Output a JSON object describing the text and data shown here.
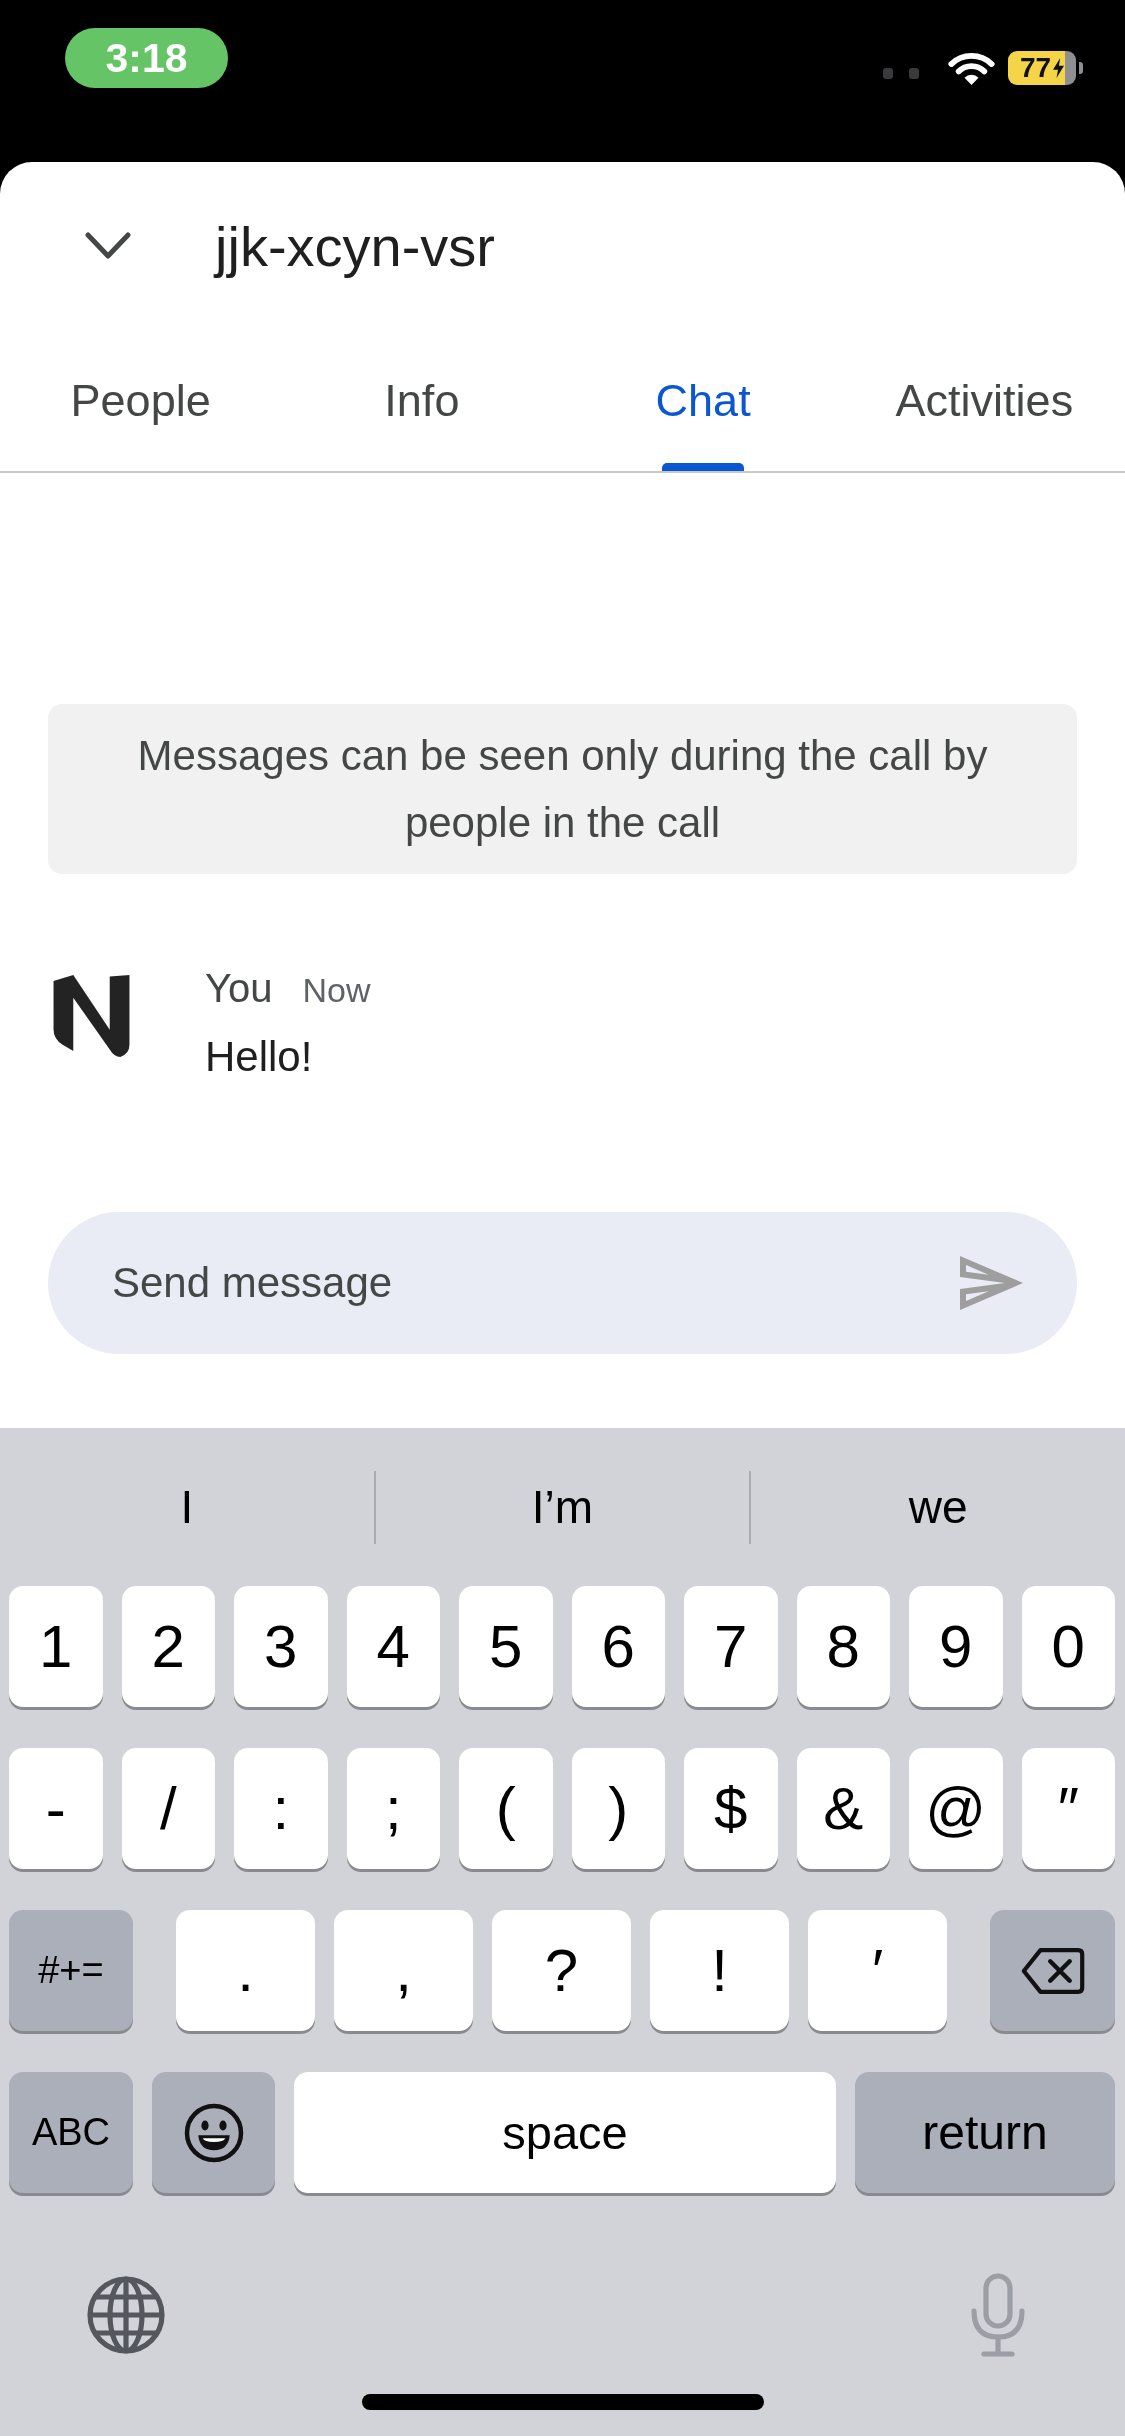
{
  "status_bar": {
    "time": "3:18",
    "battery": "77",
    "charging": true
  },
  "header": {
    "title": "jjk-xcyn-vsr"
  },
  "tabs": [
    {
      "label": "People",
      "selected": false
    },
    {
      "label": "Info",
      "selected": false
    },
    {
      "label": "Chat",
      "selected": true
    },
    {
      "label": "Activities",
      "selected": false
    }
  ],
  "notice": "Messages can be seen only during the call by people in the call",
  "messages": [
    {
      "sender": "You",
      "time": "Now",
      "text": "Hello!"
    }
  ],
  "composer": {
    "placeholder": "Send message"
  },
  "keyboard": {
    "suggestions": [
      "I",
      "I’m",
      "we"
    ],
    "key_rows": [
      {
        "keys": [
          {
            "label": "1",
            "kind": "char"
          },
          {
            "label": "2",
            "kind": "char"
          },
          {
            "label": "3",
            "kind": "char"
          },
          {
            "label": "4",
            "kind": "char"
          },
          {
            "label": "5",
            "kind": "char"
          },
          {
            "label": "6",
            "kind": "char"
          },
          {
            "label": "7",
            "kind": "char"
          },
          {
            "label": "8",
            "kind": "char"
          },
          {
            "label": "9",
            "kind": "char"
          },
          {
            "label": "0",
            "kind": "char"
          }
        ]
      },
      {
        "keys": [
          {
            "label": "-",
            "kind": "char"
          },
          {
            "label": "/",
            "kind": "char"
          },
          {
            "label": ":",
            "kind": "char"
          },
          {
            "label": ";",
            "kind": "char"
          },
          {
            "label": "(",
            "kind": "char"
          },
          {
            "label": ")",
            "kind": "char"
          },
          {
            "label": "$",
            "kind": "char"
          },
          {
            "label": "&",
            "kind": "char"
          },
          {
            "label": "@",
            "kind": "char"
          },
          {
            "label": "″",
            "kind": "char"
          }
        ]
      },
      {
        "keys": [
          {
            "label": "#+=",
            "kind": "mode"
          },
          {
            "label": ".",
            "kind": "char"
          },
          {
            "label": ",",
            "kind": "char"
          },
          {
            "label": "?",
            "kind": "char"
          },
          {
            "label": "!",
            "kind": "char"
          },
          {
            "label": "′",
            "kind": "char"
          },
          {
            "kind": "backspace"
          }
        ]
      },
      {
        "keys": [
          {
            "label": "ABC",
            "kind": "mode"
          },
          {
            "kind": "emoji"
          },
          {
            "label": "space",
            "kind": "space"
          },
          {
            "label": "return",
            "kind": "return"
          }
        ]
      }
    ]
  }
}
